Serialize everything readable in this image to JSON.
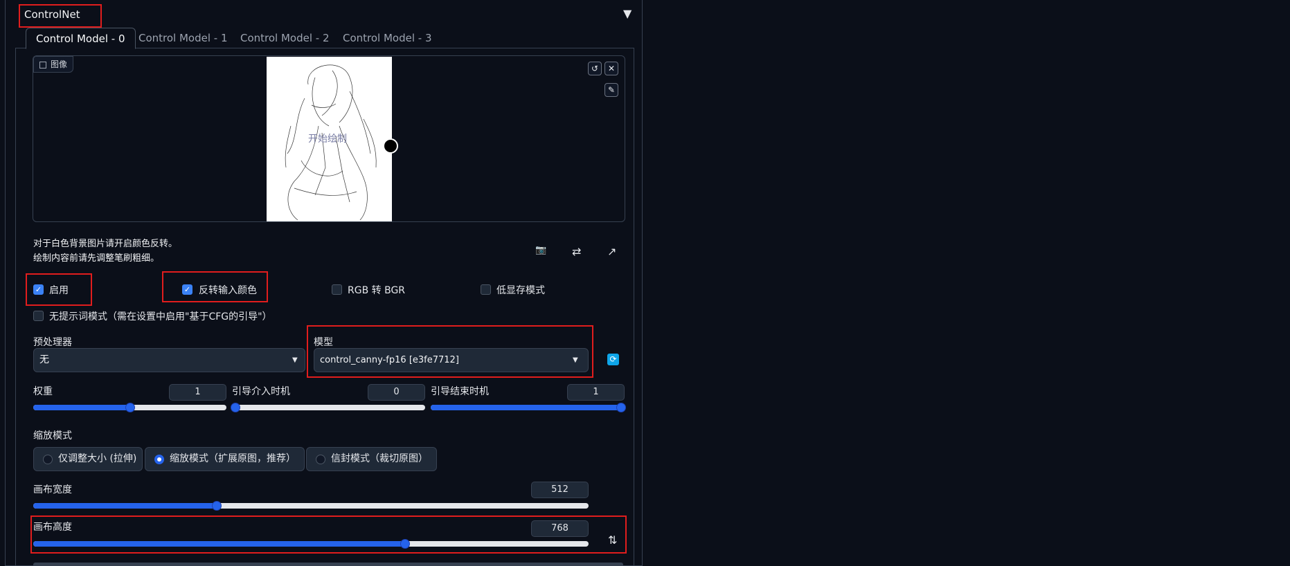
{
  "panel": {
    "title": "ControlNet",
    "collapse_icon": "▼"
  },
  "tabs": [
    "Control Model - 0",
    "Control Model - 1",
    "Control Model - 2",
    "Control Model - 3"
  ],
  "image": {
    "label": "图像",
    "canvas_text": "开始绘制"
  },
  "hints": {
    "line1": "对于白色背景图片请开启颜色反转。",
    "line2": "绘制内容前请先调整笔刷粗细。"
  },
  "checkboxes": {
    "enable": {
      "label": "启用",
      "checked": true
    },
    "invert": {
      "label": "反转输入颜色",
      "checked": true
    },
    "rgb2bgr": {
      "label": "RGB 转 BGR",
      "checked": false
    },
    "lowvram": {
      "label": "低显存模式",
      "checked": false
    },
    "guess": {
      "label": "无提示词模式（需在设置中启用\"基于CFG的引导\"）",
      "checked": false
    }
  },
  "preprocessor": {
    "label": "预处理器",
    "value": "无"
  },
  "model": {
    "label": "模型",
    "value": "control_canny-fp16 [e3fe7712]"
  },
  "weight": {
    "label": "权重",
    "value": "1",
    "fraction": 0.5
  },
  "guidance_start": {
    "label": "引导介入时机",
    "value": "0",
    "fraction": 0.0
  },
  "guidance_end": {
    "label": "引导结束时机",
    "value": "1",
    "fraction": 1.0
  },
  "resize_mode": {
    "label": "缩放模式",
    "options": [
      "仅调整大小 (拉伸)",
      "缩放模式（扩展原图，推荐）",
      "信封模式（裁切原图）"
    ],
    "selected": 1
  },
  "canvas_width": {
    "label": "画布宽度",
    "value": "512",
    "fraction": 0.33
  },
  "canvas_height": {
    "label": "画布高度",
    "value": "768",
    "fraction": 0.67
  },
  "colors": {
    "accent": "#2563eb",
    "highlight": "#e11d1d",
    "background": "#0b0f19"
  }
}
